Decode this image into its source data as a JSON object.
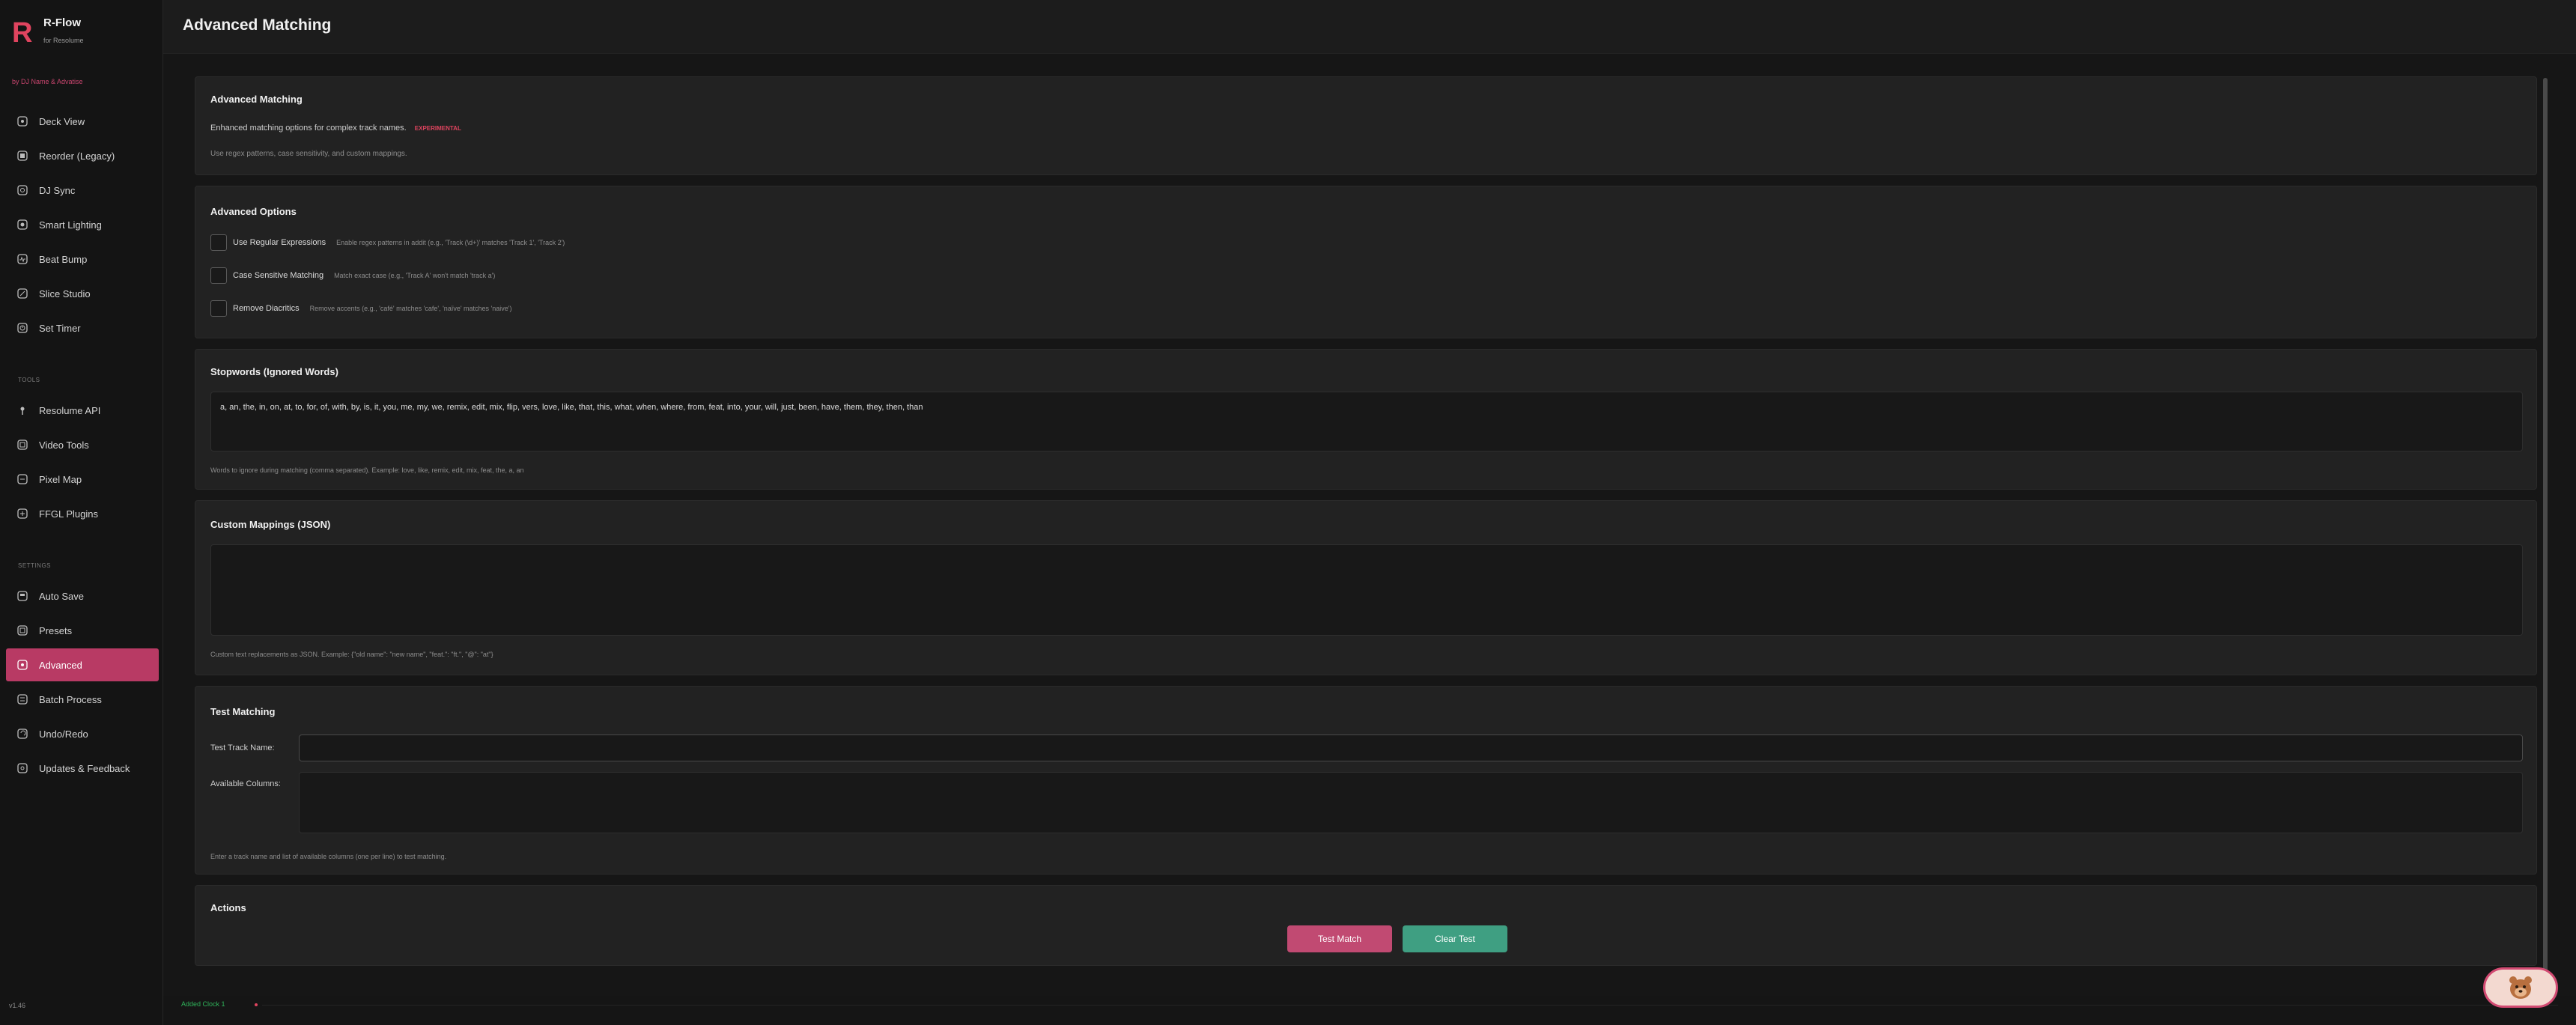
{
  "brand": {
    "name": "R-Flow",
    "subtitle": "for Resolume",
    "byline": "by DJ Name & Advatise",
    "logo_letter": "R"
  },
  "sidebar": {
    "items": [
      {
        "label": "Deck View",
        "icon": "grid-icon"
      },
      {
        "label": "Reorder (Legacy)",
        "icon": "reorder-icon"
      },
      {
        "label": "DJ Sync",
        "icon": "sync-icon"
      },
      {
        "label": "Smart Lighting",
        "icon": "lightbulb-icon"
      },
      {
        "label": "Beat Bump",
        "icon": "beat-icon"
      },
      {
        "label": "Slice Studio",
        "icon": "slice-icon"
      },
      {
        "label": "Set Timer",
        "icon": "timer-icon"
      }
    ],
    "tools_heading": "TOOLS",
    "tools": [
      {
        "label": "Resolume API",
        "icon": "pin-icon"
      },
      {
        "label": "Video Tools",
        "icon": "video-icon"
      },
      {
        "label": "Pixel Map",
        "icon": "pixel-map-icon"
      },
      {
        "label": "FFGL Plugins",
        "icon": "plugin-icon"
      }
    ],
    "settings_heading": "SETTINGS",
    "settings": [
      {
        "label": "Auto Save",
        "icon": "save-icon"
      },
      {
        "label": "Presets",
        "icon": "presets-icon"
      },
      {
        "label": "Advanced",
        "icon": "advanced-icon",
        "active": true
      },
      {
        "label": "Batch Process",
        "icon": "batch-icon"
      },
      {
        "label": "Undo/Redo",
        "icon": "undo-icon"
      },
      {
        "label": "Updates & Feedback",
        "icon": "feedback-icon"
      }
    ],
    "version": "v1.46"
  },
  "header": {
    "title": "Advanced Matching"
  },
  "cards": {
    "intro": {
      "title": "Advanced Matching",
      "description": "Enhanced matching options for complex track names.",
      "badge": "EXPERIMENTAL",
      "hint": "Use regex patterns, case sensitivity, and custom mappings."
    },
    "options": {
      "title": "Advanced Options",
      "items": [
        {
          "label": "Use Regular Expressions",
          "help": "Enable regex patterns in addit (e.g., 'Track (\\d+)' matches 'Track 1', 'Track 2')",
          "checked": false
        },
        {
          "label": "Case Sensitive Matching",
          "help": "Match exact case (e.g., 'Track A' won't match 'track a')",
          "checked": false
        },
        {
          "label": "Remove Diacritics",
          "help": "Remove accents (e.g., 'café' matches 'cafe', 'naïve' matches 'naive')",
          "checked": false
        }
      ]
    },
    "stopwords": {
      "title": "Stopwords (Ignored Words)",
      "value": "a, an, the, in, on, at, to, for, of, with, by, is, it, you, me, my, we, remix, edit, mix, flip, vers, love, like, that, this, what, when, where, from, feat, into, your, will, just, been, have, them, they, then, than",
      "help": "Words to ignore during matching (comma separated). Example: love, like, remix, edit, mix, feat, the, a, an"
    },
    "mappings": {
      "title": "Custom Mappings (JSON)",
      "value": "",
      "help": "Custom text replacements as JSON. Example: {\"old name\": \"new name\", \"feat.\": \"ft.\", \"@\": \"at\"}"
    },
    "test": {
      "title": "Test Matching",
      "track_label": "Test Track Name:",
      "track_value": "",
      "columns_label": "Available Columns:",
      "columns_value": "",
      "help": "Enter a track name and list of available columns (one per line) to test matching."
    },
    "actions": {
      "title": "Actions",
      "test_button": "Test Match",
      "clear_button": "Clear Test"
    }
  },
  "status": {
    "text": "Added Clock 1"
  },
  "colors": {
    "accent": "#b83a64",
    "test_button": "#c14a72",
    "clear_button": "#3f9f82",
    "badge": "#e0445f",
    "status_ok": "#2fb35a"
  }
}
